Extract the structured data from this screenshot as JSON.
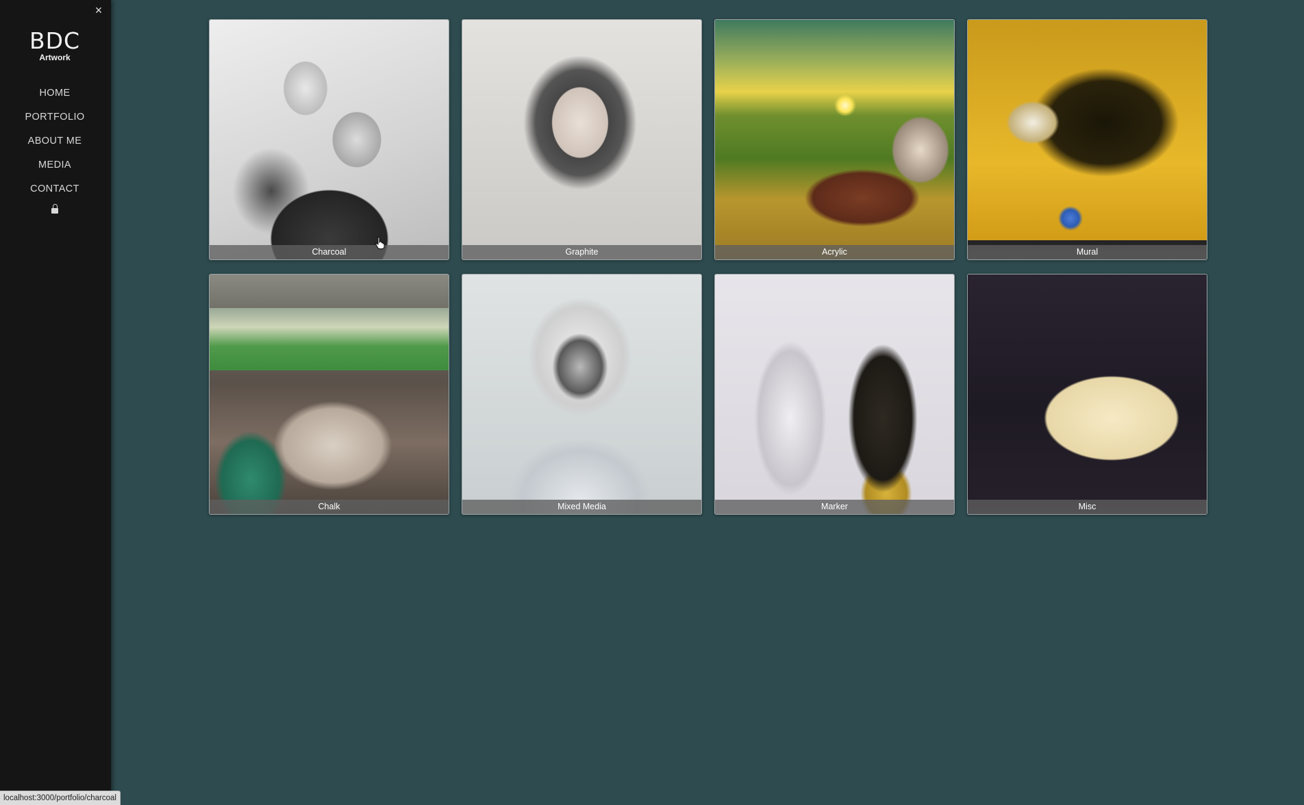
{
  "sidebar": {
    "close_icon": "×",
    "brand": {
      "title": "BDC",
      "subtitle": "Artwork"
    },
    "nav": [
      {
        "label": "HOME"
      },
      {
        "label": "PORTFOLIO"
      },
      {
        "label": "ABOUT ME"
      },
      {
        "label": "MEDIA"
      },
      {
        "label": "CONTACT"
      }
    ],
    "lock_icon": "lock-icon"
  },
  "gallery": {
    "items": [
      {
        "label": "Charcoal",
        "art": "charcoal-portrait-couple"
      },
      {
        "label": "Graphite",
        "art": "graphite-portrait-woman"
      },
      {
        "label": "Acrylic",
        "art": "acrylic-tractor-field-sunset"
      },
      {
        "label": "Mural",
        "art": "mural-hawkeye-mascot"
      },
      {
        "label": "Chalk",
        "art": "chalk-street-art"
      },
      {
        "label": "Mixed Media",
        "art": "mixed-media-football-player"
      },
      {
        "label": "Marker",
        "art": "marker-football-players"
      },
      {
        "label": "Misc",
        "art": "misc-3d-stairs-drawing"
      }
    ]
  },
  "status_bar": {
    "url": "localhost:3000/portfolio/charcoal"
  },
  "colors": {
    "page_background": "#2e4b4f",
    "sidebar_background": "#151515",
    "label_bar": "#5f5f5f"
  }
}
